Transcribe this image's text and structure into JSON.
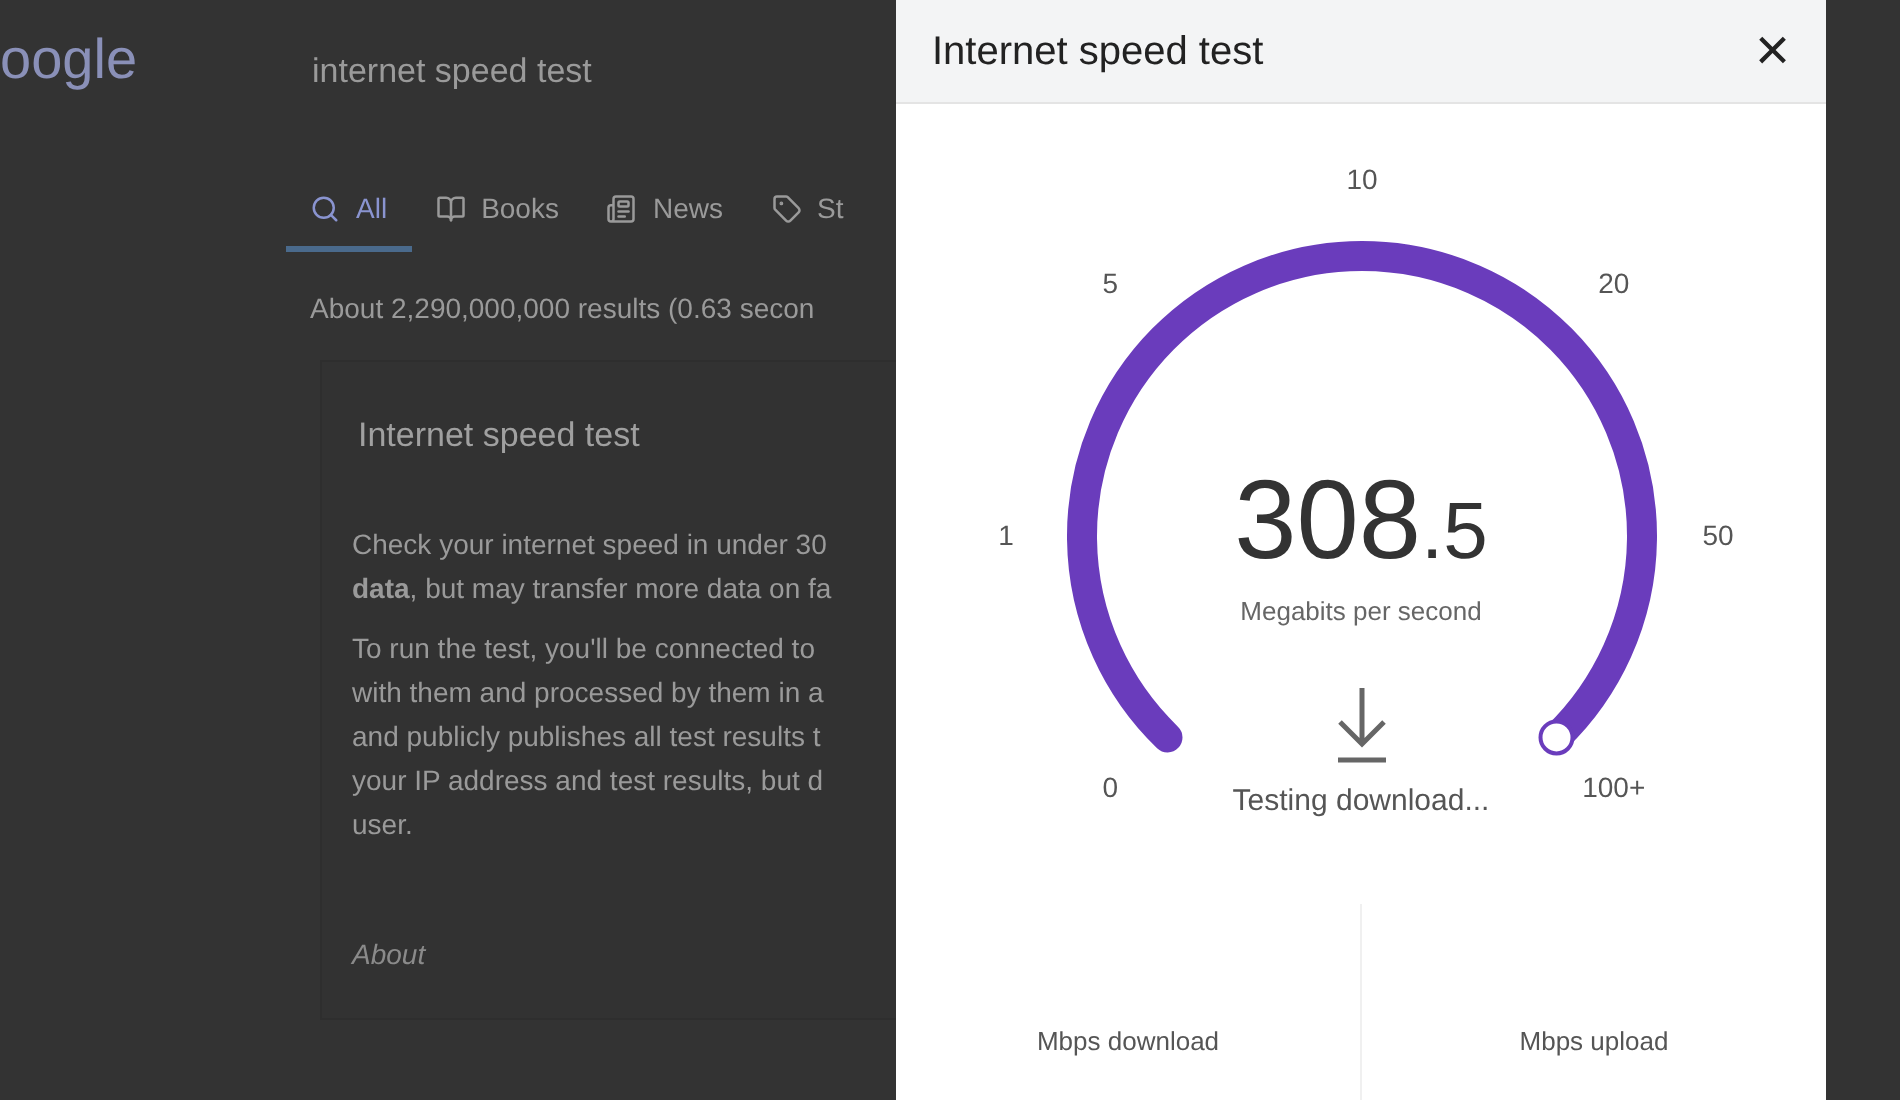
{
  "background_page": {
    "logo": "oogle",
    "search_query": "internet speed test",
    "tabs": [
      {
        "label": "All",
        "kind": "search",
        "selected": true
      },
      {
        "label": "Books",
        "kind": "book",
        "selected": false
      },
      {
        "label": "News",
        "kind": "news",
        "selected": false
      },
      {
        "label": "St",
        "kind": "tag",
        "selected": false
      }
    ],
    "results_count": "About 2,290,000,000 results (0.63 secon",
    "card": {
      "title": "Internet speed test",
      "paragraphs": [
        [
          "Check your internet speed in under 30",
          "**data**, but may transfer more data on fa"
        ],
        [
          "To run the test, you'll be connected to",
          "with them and processed by them in a",
          "and publicly publishes all test results t",
          "your IP address and test results, but d",
          "user."
        ]
      ],
      "footer": "About"
    }
  },
  "dialog": {
    "title": "Internet speed test",
    "close": "×",
    "gauge": {
      "ticks": [
        "0",
        "1",
        "5",
        "10",
        "20",
        "50",
        "100+"
      ],
      "value": "308",
      "decimal": ".5",
      "unit": "Megabits per second",
      "status": "Testing download..."
    },
    "results": [
      {
        "label": "Mbps download"
      },
      {
        "label": "Mbps upload"
      }
    ]
  }
}
